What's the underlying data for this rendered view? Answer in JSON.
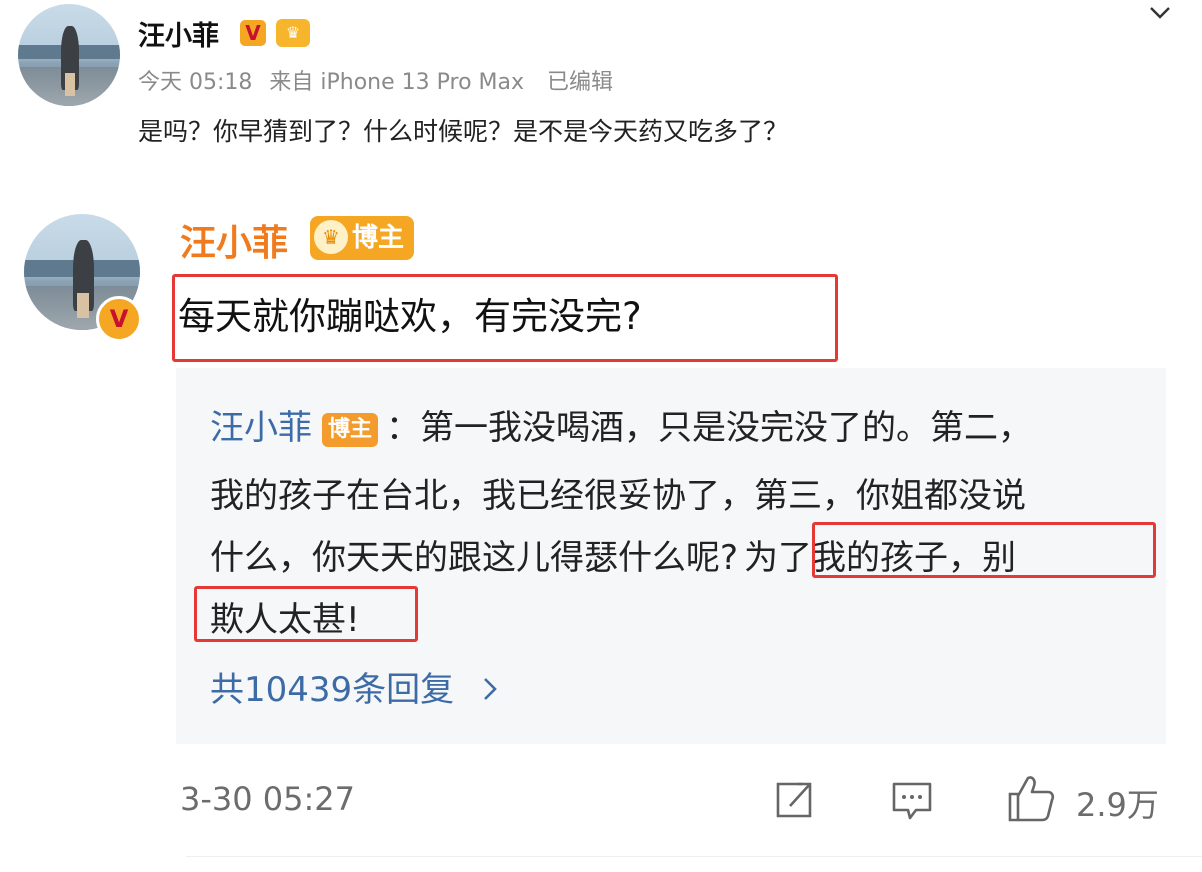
{
  "post": {
    "author": "汪小菲",
    "time": "今天 05:18",
    "source": "来自 iPhone 13 Pro Max",
    "edited": "已编辑",
    "content": "是吗？你早猜到了？什么时候呢？是不是今天药又吃多了？",
    "verified_badge": "V"
  },
  "comment": {
    "author": "汪小菲",
    "author_badge": "博主",
    "text": "每天就你蹦哒欢，有完没完?",
    "quoted_reply": {
      "author": "汪小菲",
      "badge": "博主",
      "line1": "：第一我没喝酒，只是没完没了的。第二，",
      "line2": "我的孩子在台北，我已经很妥协了，第三，你姐都没说",
      "line3a": "什么，你天天的跟这儿得瑟什么呢?",
      "line3b": "为了我的孩子，别",
      "line4": "欺人太甚!"
    },
    "reply_count": "共10439条回复",
    "timestamp": "3-30 05:27",
    "likes": "2.9万"
  },
  "icons": {
    "more": "chevron-down-icon",
    "share": "share-icon",
    "comment": "comment-icon",
    "like": "thumbs-up-icon",
    "reply_arrow": "chevron-right-icon"
  },
  "colors": {
    "name_orange": "#f07b1f",
    "link_blue": "#3d6ba6",
    "highlight_red": "#e53935",
    "badge_orange": "#f5a623",
    "quote_bg": "#f6f7f9"
  }
}
